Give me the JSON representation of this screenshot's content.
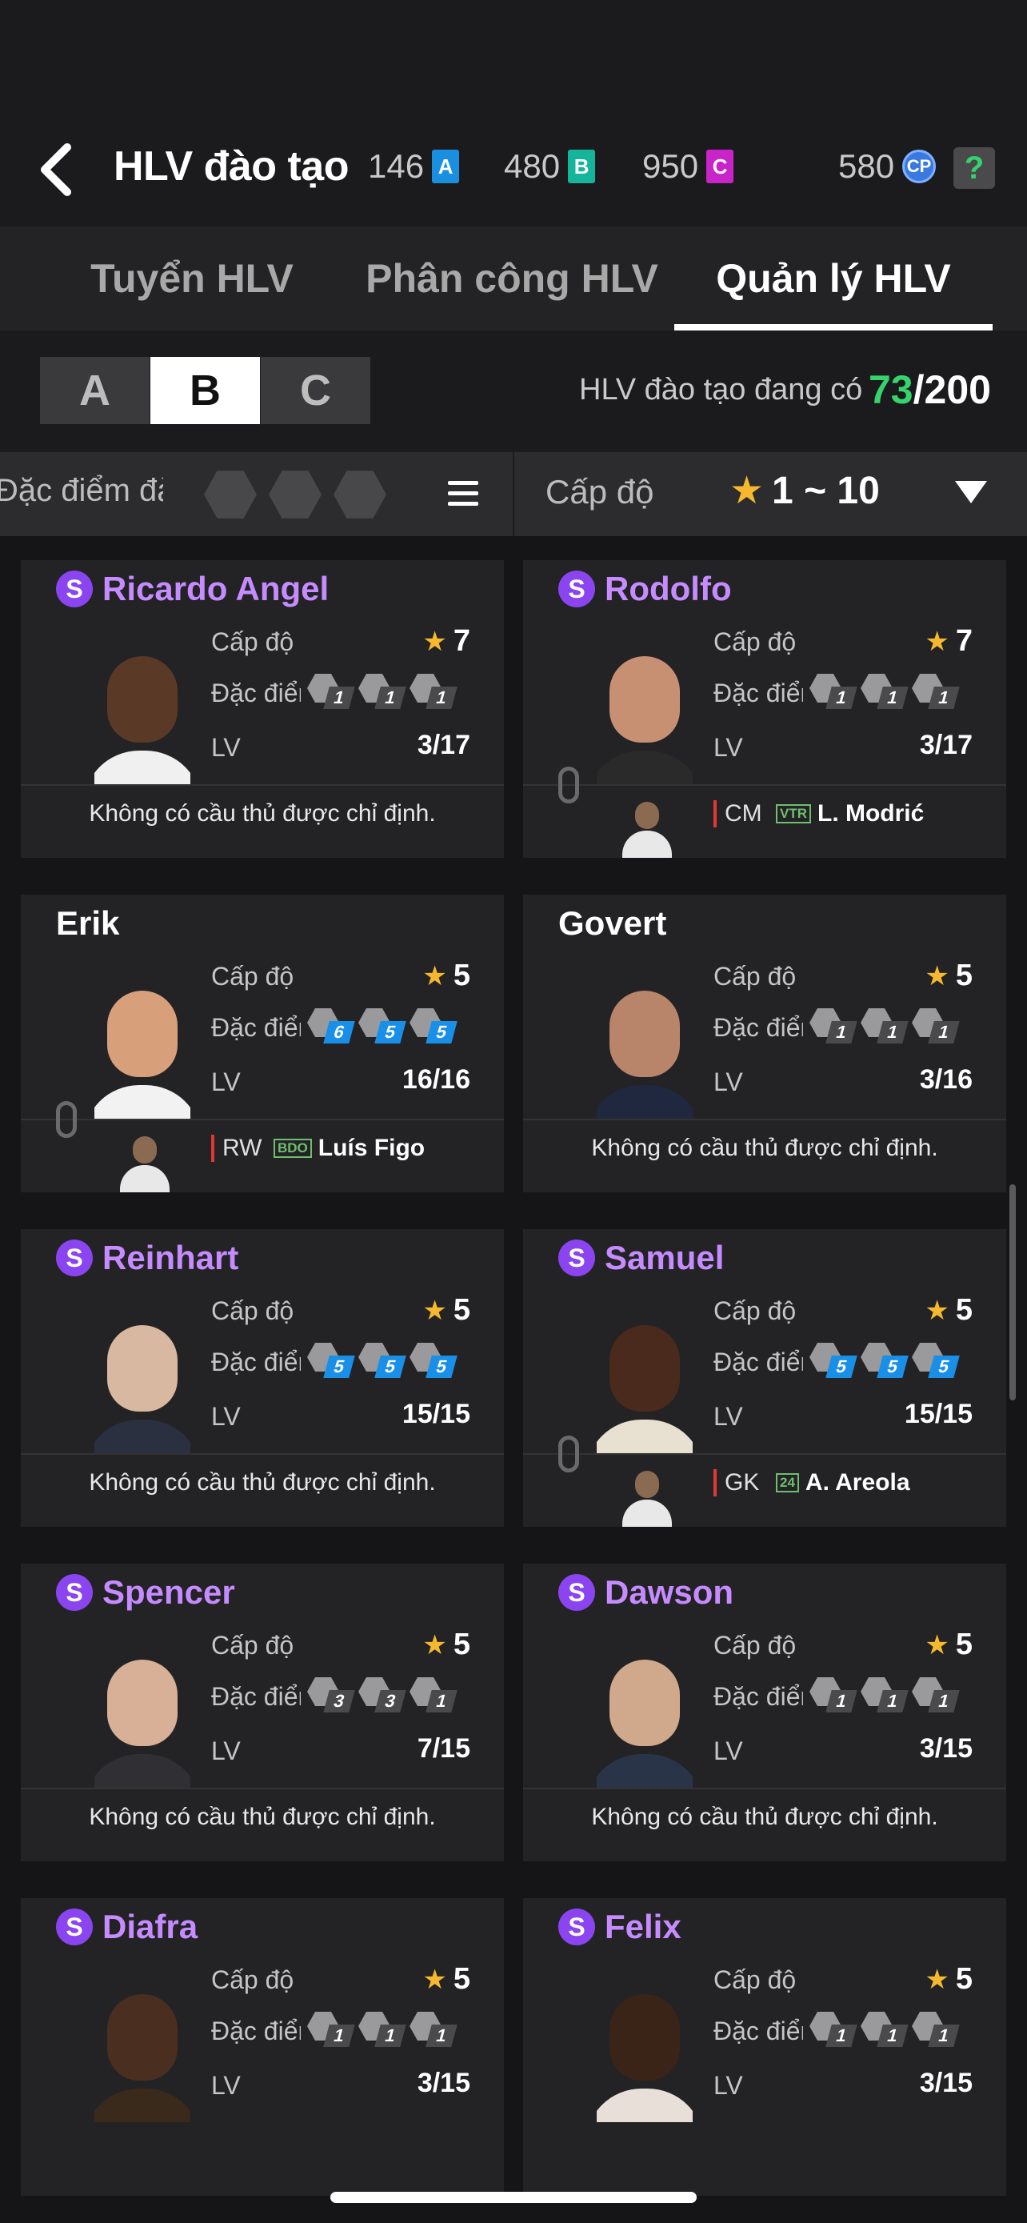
{
  "header": {
    "title": "HLV đào tạo",
    "currencies": [
      {
        "value": "146",
        "icon": "A",
        "color": "#1a8fe0"
      },
      {
        "value": "480",
        "icon": "B",
        "color": "#14b59a"
      },
      {
        "value": "950",
        "icon": "C",
        "color": "#c824c9"
      },
      {
        "value": "580",
        "icon": "CP",
        "color": "#3a7ae0"
      }
    ],
    "help_label": "?"
  },
  "tabs": [
    {
      "label": "Tuyển HLV",
      "active": false
    },
    {
      "label": "Phân công HLV",
      "active": false
    },
    {
      "label": "Quản lý HLV",
      "active": true
    }
  ],
  "grades": [
    {
      "label": "A",
      "active": false
    },
    {
      "label": "B",
      "active": true
    },
    {
      "label": "C",
      "active": false
    }
  ],
  "count": {
    "label": "HLV đào tạo đang có",
    "current": "73",
    "total": "/200"
  },
  "filter": {
    "trait_label": "Đặc điểm đào tạo",
    "level_label": "Cấp độ",
    "level_range": "1 ~ 10"
  },
  "labels": {
    "level": "Cấp độ",
    "trait": "Đặc điểm",
    "lv": "LV",
    "no_player": "Không có cầu thủ được chỉ định."
  },
  "coaches": [
    {
      "name": "Ricardo Angel",
      "special": true,
      "stars": "7",
      "lv": "3/17",
      "traits": [
        "1",
        "1",
        "1"
      ],
      "blue": false,
      "assigned": null,
      "skin": "#5a3a26",
      "shirt": "#f0f0f0"
    },
    {
      "name": "Rodolfo",
      "special": true,
      "stars": "7",
      "lv": "3/17",
      "traits": [
        "1",
        "1",
        "1"
      ],
      "blue": false,
      "assigned": {
        "position": "CM",
        "club": "VTR",
        "player": "L. Modrić"
      },
      "skin": "#c89072",
      "shirt": "#2a2a2a"
    },
    {
      "name": "Erik",
      "special": false,
      "stars": "5",
      "lv": "16/16",
      "traits": [
        "6",
        "5",
        "5"
      ],
      "blue": true,
      "assigned": {
        "position": "RW",
        "club": "BDO",
        "player": "Luís Figo"
      },
      "skin": "#d8a07a",
      "shirt": "#f2f2f2"
    },
    {
      "name": "Govert",
      "special": false,
      "stars": "5",
      "lv": "3/16",
      "traits": [
        "1",
        "1",
        "1"
      ],
      "blue": false,
      "assigned": null,
      "skin": "#b8846a",
      "shirt": "#202840"
    },
    {
      "name": "Reinhart",
      "special": true,
      "stars": "5",
      "lv": "15/15",
      "traits": [
        "5",
        "5",
        "5"
      ],
      "blue": true,
      "assigned": null,
      "skin": "#d8b8a0",
      "shirt": "#2a3040"
    },
    {
      "name": "Samuel",
      "special": true,
      "stars": "5",
      "lv": "15/15",
      "traits": [
        "5",
        "5",
        "5"
      ],
      "blue": true,
      "assigned": {
        "position": "GK",
        "club": "24",
        "player": "A. Areola"
      },
      "skin": "#4a2a1c",
      "shirt": "#e8e0d0"
    },
    {
      "name": "Spencer",
      "special": true,
      "stars": "5",
      "lv": "7/15",
      "traits": [
        "3",
        "3",
        "1"
      ],
      "blue": false,
      "assigned": null,
      "skin": "#d8b098",
      "shirt": "#303034"
    },
    {
      "name": "Dawson",
      "special": true,
      "stars": "5",
      "lv": "3/15",
      "traits": [
        "1",
        "1",
        "1"
      ],
      "blue": false,
      "assigned": null,
      "skin": "#d0a88c",
      "shirt": "#2a3448"
    },
    {
      "name": "Diafra",
      "special": true,
      "stars": "5",
      "lv": "3/15",
      "traits": [
        "1",
        "1",
        "1"
      ],
      "blue": false,
      "assigned": null,
      "skin": "#4a2e20",
      "shirt": "#3a2a1c"
    },
    {
      "name": "Felix",
      "special": true,
      "stars": "5",
      "lv": "3/15",
      "traits": [
        "1",
        "1",
        "1"
      ],
      "blue": false,
      "assigned": null,
      "skin": "#3a2418",
      "shirt": "#e8e0d8"
    }
  ]
}
